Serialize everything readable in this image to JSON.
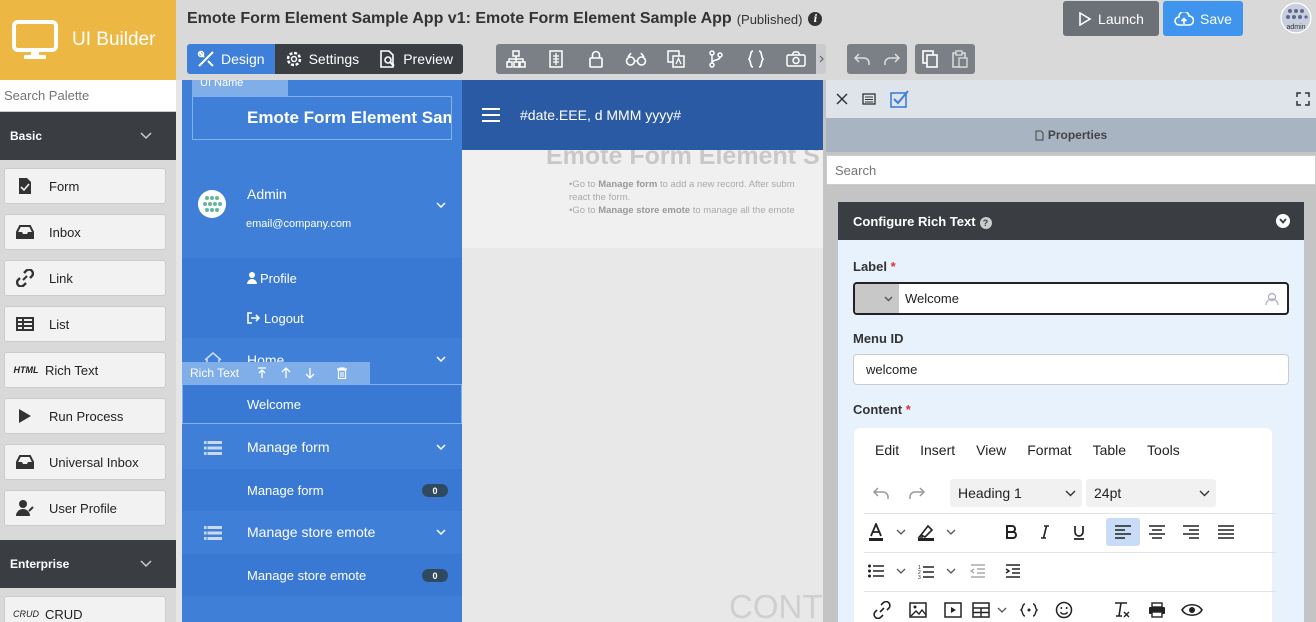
{
  "palette": {
    "brand": "UI Builder",
    "search_placeholder": "Search Palette",
    "categories": [
      {
        "label": "Basic"
      },
      {
        "label": "Enterprise"
      }
    ],
    "basic_items": [
      {
        "label": "Form",
        "icon": "form-icon"
      },
      {
        "label": "Inbox",
        "icon": "inbox-icon"
      },
      {
        "label": "Link",
        "icon": "link-icon"
      },
      {
        "label": "List",
        "icon": "list-icon"
      },
      {
        "label": "Rich Text",
        "icon": "html-icon",
        "icon_text": "HTML"
      },
      {
        "label": "Run Process",
        "icon": "play-icon"
      },
      {
        "label": "Universal Inbox",
        "icon": "inbox-icon"
      },
      {
        "label": "User Profile",
        "icon": "user-icon"
      }
    ],
    "enterprise_items": [
      {
        "label": "CRUD",
        "icon": "crud-icon",
        "icon_text": "CRUD"
      }
    ]
  },
  "topbar": {
    "app_title": "Emote Form Element Sample App v1: Emote Form Element Sample App",
    "status": "(Published)",
    "tabs": [
      {
        "label": "Design",
        "active": true
      },
      {
        "label": "Settings",
        "active": false
      },
      {
        "label": "Preview",
        "active": false
      }
    ],
    "launch_label": "Launch",
    "save_label": "Save",
    "avatar_text": "admin"
  },
  "canvas": {
    "ui_name_tag": "UI Name",
    "app_name": "Emote Form Element Sample App",
    "date_format": "#date.EEE, d MMM yyyy#",
    "user_name": "Admin",
    "user_email": "email@company.com",
    "profile_label": "Profile",
    "logout_label": "Logout",
    "home_label": "Home",
    "rich_text_tag": "Rich Text",
    "welcome_label": "Welcome",
    "menu": [
      {
        "category": "Manage form",
        "item": "Manage form",
        "count": "0"
      },
      {
        "category": "Manage store emote",
        "item": "Manage store emote",
        "count": "0"
      }
    ],
    "page_heading": "Emote Form Element S",
    "instructions": [
      {
        "pre": "•Go to ",
        "bold": "Manage form",
        "post": " to add a new record. After subm"
      },
      {
        "pre": " react the form.",
        "bold": "",
        "post": ""
      },
      {
        "pre": "•Go to ",
        "bold": "Manage store emote",
        "post": " to manage all the emote"
      }
    ],
    "faint_text": "CONT"
  },
  "properties": {
    "title": "Properties",
    "search_placeholder": "Search",
    "section_title": "Configure Rich Text",
    "label_field": {
      "label": "Label",
      "value": "Welcome"
    },
    "menu_id_field": {
      "label": "Menu ID",
      "value": "welcome"
    },
    "content_label": "Content",
    "editor": {
      "menus": [
        "Edit",
        "Insert",
        "View",
        "Format",
        "Table",
        "Tools"
      ],
      "block_format": "Heading 1",
      "font_size": "24pt"
    }
  },
  "colors": {
    "brand": "#ecb843",
    "accent": "#3e7fd9",
    "menu_bg": "#3f7fd8",
    "header_bg": "#2b5aa4",
    "dark": "#3a3e43"
  }
}
